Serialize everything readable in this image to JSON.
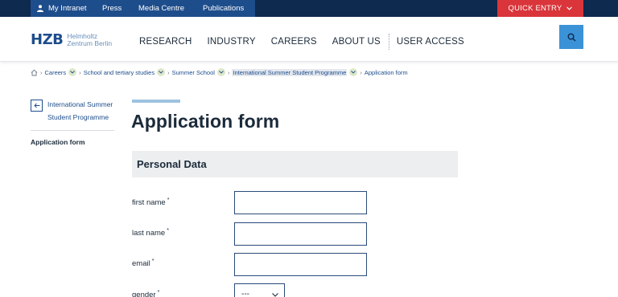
{
  "utility_bar": {
    "links": [
      "My Intranet",
      "Press",
      "Media Centre",
      "Publications"
    ],
    "quick_entry": "QUICK ENTRY"
  },
  "header": {
    "logo": {
      "mark": "HZB",
      "line1": "Helmholtz",
      "line2": "Zentrum Berlin"
    },
    "nav": [
      "RESEARCH",
      "INDUSTRY",
      "CAREERS",
      "ABOUT US",
      "USER ACCESS"
    ]
  },
  "breadcrumb": [
    "Careers",
    "School and tertiary studies",
    "Summer School",
    "International Summer Student Programme",
    "Application form"
  ],
  "sidebar": {
    "back_label": "International Summer Student Programme",
    "current": "Application form"
  },
  "main": {
    "title": "Application form",
    "section_title": "Personal Data",
    "fields": {
      "first_name": {
        "label": "first name",
        "required": "*",
        "value": ""
      },
      "last_name": {
        "label": "last name",
        "required": "*",
        "value": ""
      },
      "email": {
        "label": "email",
        "required": "*",
        "value": ""
      },
      "gender": {
        "label": "gender",
        "required": "*",
        "value": "---"
      }
    }
  },
  "colors": {
    "navy": "#0e2a4e",
    "blue": "#1e4d8c",
    "quick_entry_red": "#d9353a",
    "search_blue": "#3b92d6"
  },
  "icons": [
    "person-icon",
    "chevron-down-icon",
    "search-icon",
    "home-icon",
    "arrow-left-icon"
  ]
}
